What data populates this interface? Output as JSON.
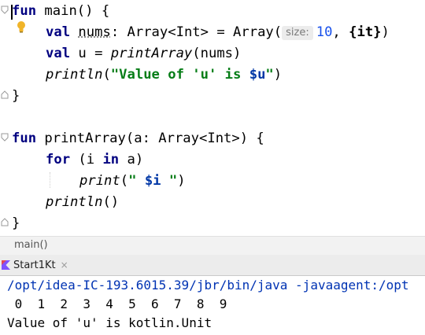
{
  "editor": {
    "line1": {
      "kw": "fun",
      "rest": " main() {"
    },
    "line2": {
      "kw": "val",
      "name": "nums",
      "type": ": Array<Int> = Array(",
      "hint": "size:",
      "num": "10",
      "comma": ", ",
      "lambda": "{it}",
      "close": ")"
    },
    "line3": {
      "kw": "val",
      "rest": " u = ",
      "call": "printArray",
      "args": "(nums)"
    },
    "line4": {
      "call": "println",
      "open": "(",
      "str": "\"Value of 'u' is ",
      "tpl": "$u",
      "strEnd": "\"",
      "close": ")"
    },
    "line5": {
      "text": "}"
    },
    "line6": {
      "kw": "fun",
      "rest": " printArray(a: Array<Int>) {"
    },
    "line7": {
      "kw": "for",
      "open": " (i ",
      "kw2": "in",
      "rest": " a)"
    },
    "line8": {
      "call": "print",
      "open": "(",
      "str": "\" ",
      "tpl": "$i",
      "strEnd": " \"",
      "close": ")"
    },
    "line9": {
      "call": "println",
      "rest": "()"
    },
    "line10": {
      "text": "}"
    }
  },
  "breadcrumb": {
    "text": "main()"
  },
  "run": {
    "tab_label": "Start1Kt",
    "close": "×"
  },
  "console": {
    "command": "/opt/idea-IC-193.6015.39/jbr/bin/java -javaagent:/opt",
    "output1": " 0  1  2  3  4  5  6  7  8  9",
    "output2": "Value of 'u' is kotlin.Unit"
  },
  "colors": {
    "keyword": "#000080",
    "string": "#067d17",
    "number": "#1750eb",
    "console_cmd": "#0033b3"
  }
}
